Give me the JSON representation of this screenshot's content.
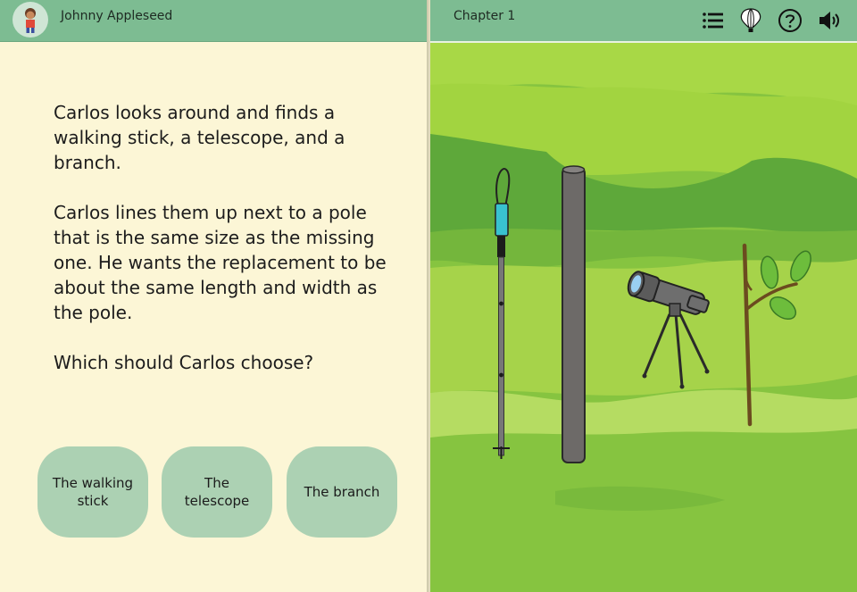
{
  "user": {
    "name": "Johnny Appleseed"
  },
  "chapter": {
    "title": "Chapter 1"
  },
  "toolbar": {
    "icons": [
      "menu-list-icon",
      "balloon-icon",
      "help-icon",
      "volume-icon"
    ]
  },
  "story": {
    "paragraphs": [
      "Carlos looks around and finds a walking stick, a telescope, and a branch.",
      "Carlos lines them up next to a pole that is the same size as the missing one. He wants the replacement to be about the same length and width as the pole.",
      "Which should Carlos choose?"
    ]
  },
  "choices": [
    {
      "label": "The walking stick"
    },
    {
      "label": "The telescope"
    },
    {
      "label": "The branch"
    }
  ],
  "colors": {
    "header": "#7dbc92",
    "page": "#fcf6d6",
    "choice": "#acd1b3",
    "grass": "#86c440"
  }
}
